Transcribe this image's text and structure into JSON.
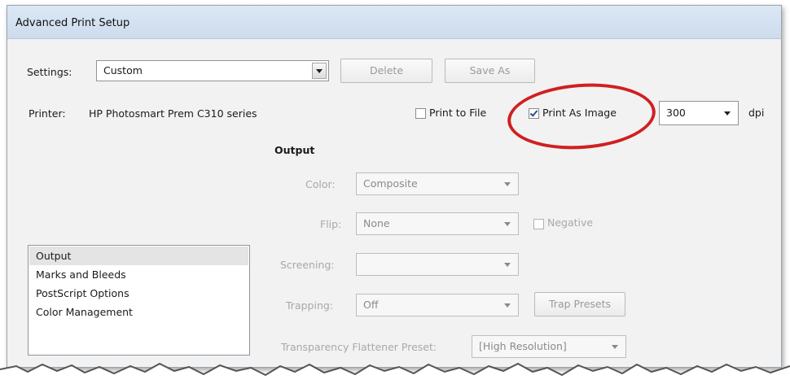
{
  "window": {
    "title": "Advanced Print Setup"
  },
  "settings": {
    "label": "Settings:",
    "value": "Custom",
    "delete_label": "Delete",
    "save_as_label": "Save As"
  },
  "printer": {
    "label": "Printer:",
    "name": "HP Photosmart Prem C310 series",
    "print_to_file_label": "Print to File",
    "print_to_file_checked": false,
    "print_as_image_label": "Print As Image",
    "print_as_image_checked": true,
    "dpi_value": "300",
    "dpi_unit": "dpi"
  },
  "categories": [
    "Output",
    "Marks and Bleeds",
    "PostScript Options",
    "Color Management"
  ],
  "selected_category": "Output",
  "output": {
    "heading": "Output",
    "color_label": "Color:",
    "color_value": "Composite",
    "flip_label": "Flip:",
    "flip_value": "None",
    "negative_label": "Negative",
    "screening_label": "Screening:",
    "screening_value": "",
    "trapping_label": "Trapping:",
    "trapping_value": "Off",
    "trap_presets_label": "Trap Presets",
    "flattener_label": "Transparency Flattener Preset:",
    "flattener_value": "[High Resolution]"
  },
  "colors": {
    "highlight_circle": "#d02020",
    "title_bar": "#cddced"
  }
}
